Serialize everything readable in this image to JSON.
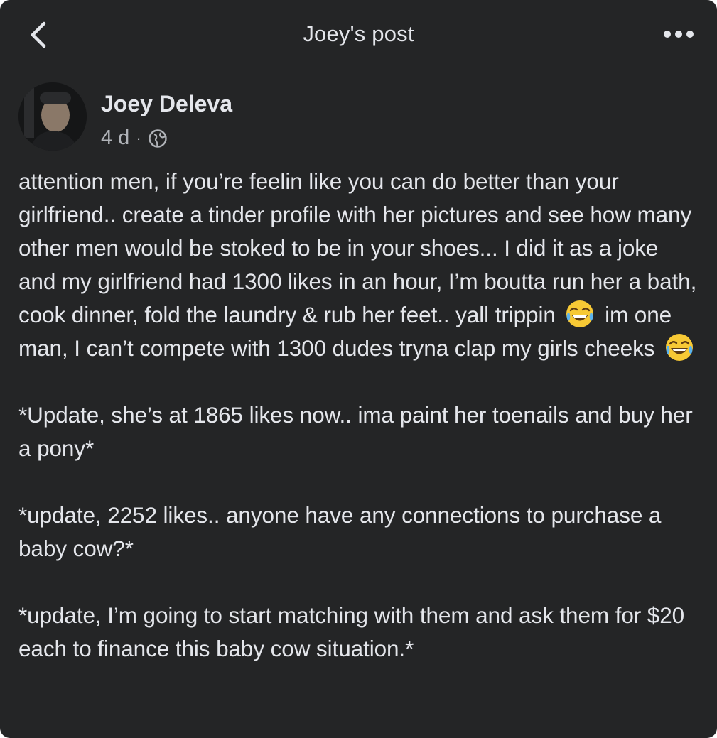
{
  "header": {
    "title": "Joey's post",
    "back_icon": "chevron-left-icon",
    "more_icon": "more-horizontal-icon"
  },
  "post": {
    "author": "Joey Deleva",
    "time": "4 d",
    "separator": "·",
    "privacy_icon": "globe-icon",
    "paragraphs": {
      "p1_a": "attention men, if you’re feelin like you can do better than your girlfriend.. create a tinder profile with her pictures and see how many other men would be stoked to be in your shoes... I did it as a joke and my girlfriend had 1300 likes in an hour, I’m boutta run her a bath, cook dinner, fold the laundry & rub her feet.. yall trippin",
      "p1_b": "im one man, I can’t compete with 1300 dudes tryna clap my girls cheeks",
      "p2": "*Update, she’s at 1865 likes now.. ima paint her toenails and buy her a pony*",
      "p3": "*update, 2252 likes.. anyone have any connections to purchase a baby cow?*",
      "p4": "*update, I’m going to start matching with them and ask them for $20 each to finance this baby cow situation.*"
    },
    "emoji": "face-with-tears-of-joy"
  },
  "colors": {
    "background": "#242526",
    "text_primary": "#e4e6eb",
    "text_secondary": "#b0b3b8",
    "emoji_yellow": "#f7c935"
  }
}
